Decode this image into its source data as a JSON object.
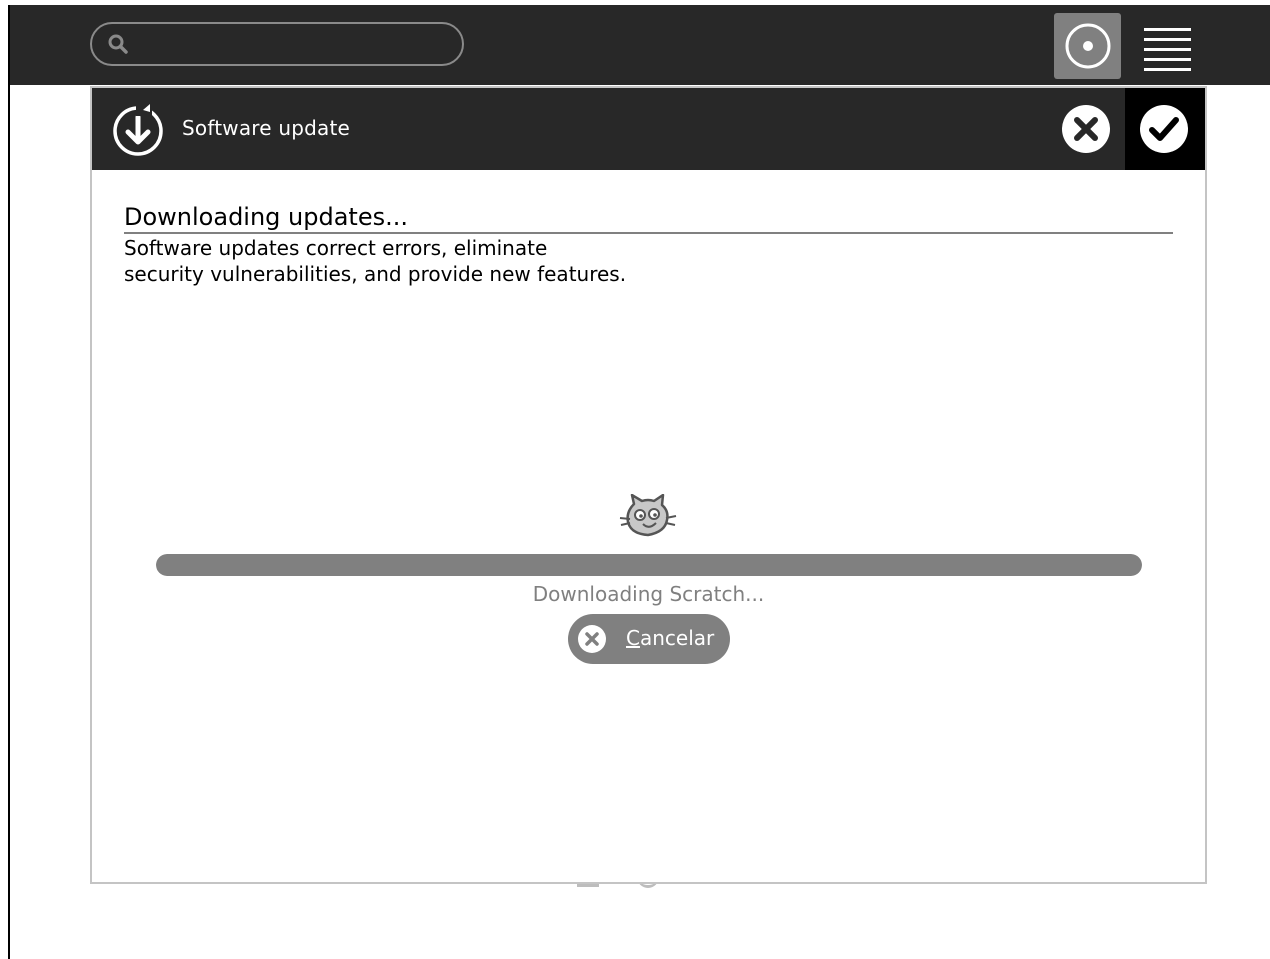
{
  "toolbar": {
    "search_placeholder": "",
    "icons": {
      "search": "search-icon",
      "activity": "activity-circle-icon",
      "menu": "hamburger-menu-icon"
    }
  },
  "dialog": {
    "title": "Software update",
    "header_icon": "update-download-icon",
    "cancel_icon": "close-circle-icon",
    "ok_icon": "checkmark-circle-icon",
    "heading": "Downloading updates...",
    "description": "Software updates correct errors, eliminate\nsecurity vulnerabilities, and provide new features.",
    "activity_icon": "scratch-cat-icon",
    "progress": {
      "value": 1.0,
      "label": "Downloading Scratch..."
    },
    "cancel_button": {
      "mnemonic": "C",
      "rest": "ancelar"
    }
  },
  "colors": {
    "toolbar_bg": "#282828",
    "accent_gray": "#808080",
    "ok_bg": "#000000"
  }
}
